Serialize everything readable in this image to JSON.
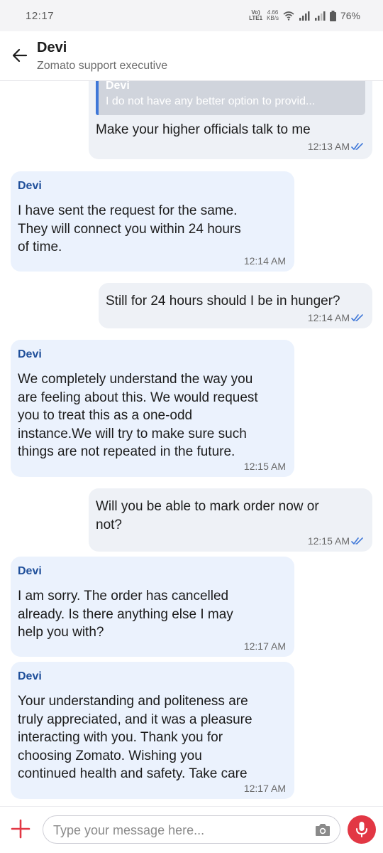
{
  "status_bar": {
    "time": "12:17",
    "volte_top": "Vo)",
    "volte_bottom": "LTE1",
    "speed_top": "4.66",
    "speed_bottom": "KB/s",
    "battery": "76%"
  },
  "header": {
    "title": "Devi",
    "subtitle": "Zomato support executive"
  },
  "messages": [
    {
      "direction": "outgoing",
      "quote_sender": "Devi",
      "quote_text": "I do not have any better option to provid...",
      "text": "Make  your higher officials talk to me",
      "time": "12:13 AM"
    },
    {
      "direction": "incoming",
      "sender": "Devi",
      "text": "I have sent the request for the same.\nThey will connect you within 24 hours\nof time.",
      "time": "12:14 AM"
    },
    {
      "direction": "outgoing",
      "text": "Still for 24 hours should I be in hunger?",
      "time": "12:14 AM"
    },
    {
      "direction": "incoming",
      "sender": "Devi",
      "text": "We completely understand the way you\nare feeling about this. We would request\nyou to treat this as a one-odd\ninstance.We will try to make sure such\nthings are not repeated in the future.",
      "time": "12:15 AM"
    },
    {
      "direction": "outgoing",
      "text": "Will you be able to mark order now or\nnot?",
      "time": "12:15 AM"
    },
    {
      "direction": "incoming",
      "sender": "Devi",
      "text": "I am sorry. The order has cancelled\nalready. Is there anything else I may\nhelp you with?",
      "time": "12:17 AM"
    },
    {
      "direction": "incoming",
      "sender": "Devi",
      "text": "Your understanding and politeness are\ntruly appreciated, and it was a pleasure\ninteracting with you. Thank you for\nchoosing Zomato. Wishing you\ncontinued health and safety. Take care",
      "time": "12:17 AM"
    }
  ],
  "composer": {
    "placeholder": "Type your message here..."
  },
  "icons": {
    "back": "arrow-left-icon",
    "read_receipt": "double-check-icon",
    "attach": "plus-icon",
    "camera": "camera-icon",
    "mic": "microphone-icon"
  },
  "colors": {
    "brand_red": "#e23744",
    "sender_blue": "#1f4f9a",
    "incoming_bubble": "#ebf2fd",
    "outgoing_bubble": "#eef1f6",
    "tick_blue": "#3e77d8"
  }
}
